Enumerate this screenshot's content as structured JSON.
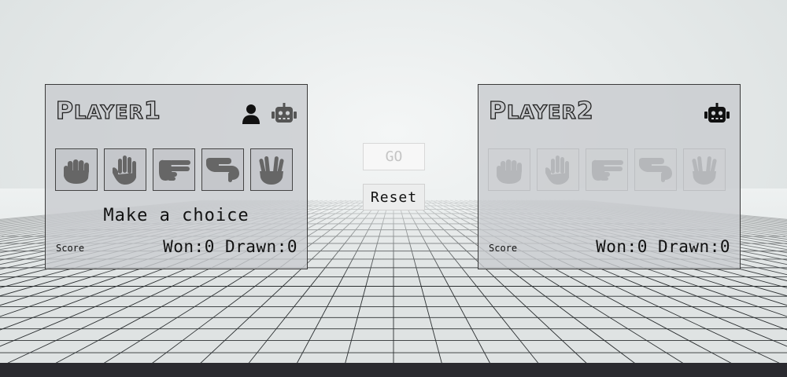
{
  "player1": {
    "title_big": "P",
    "title_rest": "LAYER",
    "title_num": "1",
    "choices": [
      "rock-icon",
      "paper-icon",
      "scissors-icon",
      "lizard-icon",
      "spock-icon"
    ],
    "message": "Make a choice",
    "score_label": "Score",
    "score_text": "Won:0 Drawn:0"
  },
  "player2": {
    "title_big": "P",
    "title_rest": "LAYER",
    "title_num": "2",
    "choices": [
      "rock-icon",
      "paper-icon",
      "scissors-icon",
      "lizard-icon",
      "spock-icon"
    ],
    "score_label": "Score",
    "score_text": "Won:0 Drawn:0"
  },
  "controls": {
    "go_label": "GO",
    "reset_label": "Reset"
  }
}
